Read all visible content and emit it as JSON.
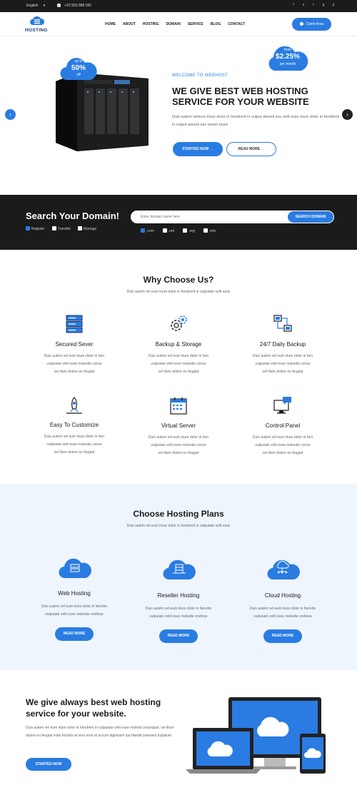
{
  "topbar": {
    "language": "English",
    "phone": "+22 555 888 555",
    "social_icons": [
      "facebook-icon",
      "skype-icon",
      "twitter-icon",
      "google-plus-icon",
      "pinterest-icon"
    ]
  },
  "header": {
    "logo_text": "HOSTING",
    "nav": [
      "HOME",
      "ABOUT",
      "HOSTING",
      "DOMAIN",
      "SERVICE",
      "BLOG",
      "CONTACT"
    ],
    "client_button": "Client Area"
  },
  "hero": {
    "badge_left": {
      "line1": "up to",
      "line2": "50%",
      "line3": "off"
    },
    "badge_right": {
      "line1": "from",
      "line2": "$2.25%",
      "line3": "per month"
    },
    "welcome": "WELCOME TO WEBHOST",
    "title": "WE GIVE BEST WEB HOSTING SERVICE FOR YOUR WEBSITE",
    "description": "Duis autem veleum iriure dolor in hendrerit in vulput ateveli ess velit esse iriure dolor in hendrerit in vulput ateveli ess velum iriure.",
    "primary_button": "STARTED NOW",
    "secondary_button": "READ MORE",
    "arrow_right": "→",
    "prev_arrow": "‹",
    "next_arrow": "›"
  },
  "search": {
    "title": "Search Your Domain!",
    "options": [
      "Register",
      "Transfer",
      "Manage"
    ],
    "input_placeholder": "Enter domain name here",
    "button": "SEARCH DOMAIN",
    "tlds": [
      ".com",
      ".net",
      ".org",
      ".info"
    ]
  },
  "why": {
    "title": "Why Choose Us?",
    "subtitle": "Duis autem vel eum iriure dolor in hendrerit in vulputate velit esse",
    "features": [
      {
        "title": "Secured Sever",
        "icon": "server-icon",
        "desc_1": "Duis autem vel eum iriure dolor in hen",
        "desc_2": "vulputate velit esse molestie conse",
        "desc_3": "vel illum dolore eu feugiat"
      },
      {
        "title": "Backup & Storage",
        "icon": "gear-icon",
        "desc_1": "Duis autem vel eum iriure dolor in hen",
        "desc_2": "vulputate velit esse molestie conse",
        "desc_3": "vel illum dolore eu feugiat"
      },
      {
        "title": "24/7 Daily Backup",
        "icon": "network-icon",
        "desc_1": "Duis autem vel eum iriure dolor in hen",
        "desc_2": "vulputate velit esse molestie conse",
        "desc_3": "vel illum dolore eu feugiat"
      },
      {
        "title": "Easy To Customize",
        "icon": "rocket-icon",
        "desc_1": "Duis autem vel eum iriure dolor in hen",
        "desc_2": "vulputate velit esse molestie conse",
        "desc_3": "vel illum dolore eu feugiat"
      },
      {
        "title": "Virtual Server",
        "icon": "calendar-icon",
        "desc_1": "Duis autem vel eum iriure dolor in hen",
        "desc_2": "vulputate velit esse molestie conse",
        "desc_3": "vel illum dolore eu feugiat"
      },
      {
        "title": "Control Panel",
        "icon": "monitor-chat-icon",
        "desc_1": "Duis autem vel eum iriure dolor in hen",
        "desc_2": "vulputate velit esse molestie conse",
        "desc_3": "vel illum dolore eu feugiat"
      }
    ]
  },
  "plans": {
    "title": "Choose Hosting Plans",
    "subtitle": "Duis autem vel eum iriure dolor in hendrerit in vulputate velit esse",
    "items": [
      {
        "title": "Web Hosting",
        "desc_1": "Duis autem vel eum iriure dolor in henshe",
        "desc_2": "vulputate velit esse molestie ondinse",
        "button": "READ MORE"
      },
      {
        "title": "Reseller Hosting",
        "desc_1": "Duis autem vel eum iriure dolor in henshe",
        "desc_2": "vulputate velit esse molestie ondinse",
        "button": "READ MORE"
      },
      {
        "title": "Cloud Hosting",
        "desc_1": "Duis autem vel eum iriure dolor in henshe",
        "desc_2": "vulputate velit esse molestie ondinse",
        "button": "READ MORE"
      }
    ]
  },
  "bottom": {
    "title": "We give always best web hosting service for your website.",
    "description": "Duis autem vel eum iriure dolor in hendrerit in vulputate velit esse molesti consequat, vel illum dolore eu feugiat nulla facilisis at vero eros et accum dignissim qui blandit praesent luptatum.",
    "button": "STARTED NOW"
  },
  "colors": {
    "accent": "#2a7ce2",
    "dark": "#1b1b1b",
    "light_bg": "#eef5fd"
  }
}
